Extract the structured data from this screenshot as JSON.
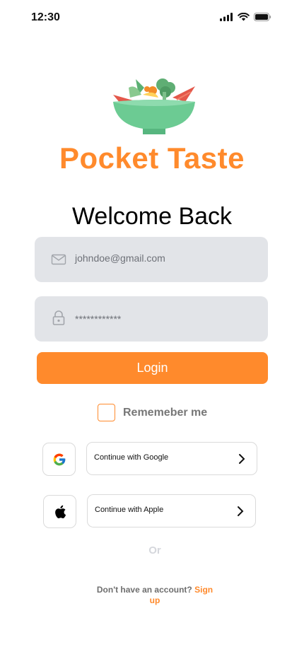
{
  "status_bar": {
    "time": "12:30",
    "icons": [
      "signal-icon",
      "wifi-icon",
      "battery-icon"
    ]
  },
  "brand": {
    "name": "Pocket Taste",
    "color": "#FF8A2C",
    "logo": "salad-bowl-icon"
  },
  "heading": "Welcome Back",
  "email": {
    "value": "johndoe@gmail.com",
    "icon": "mail-icon"
  },
  "password": {
    "value": "************",
    "icon": "lock-icon"
  },
  "login": {
    "label": "Login"
  },
  "remember": {
    "label": "Rememeber me",
    "checked": false
  },
  "social": {
    "google_label": "Continue with Google",
    "apple_label": "Continue with Apple",
    "icons": [
      "google-icon",
      "apple-icon",
      "chevron-right-icon"
    ]
  },
  "divider": "Or",
  "signup": {
    "prompt": "Don't have an account?",
    "link": "Sign up"
  }
}
